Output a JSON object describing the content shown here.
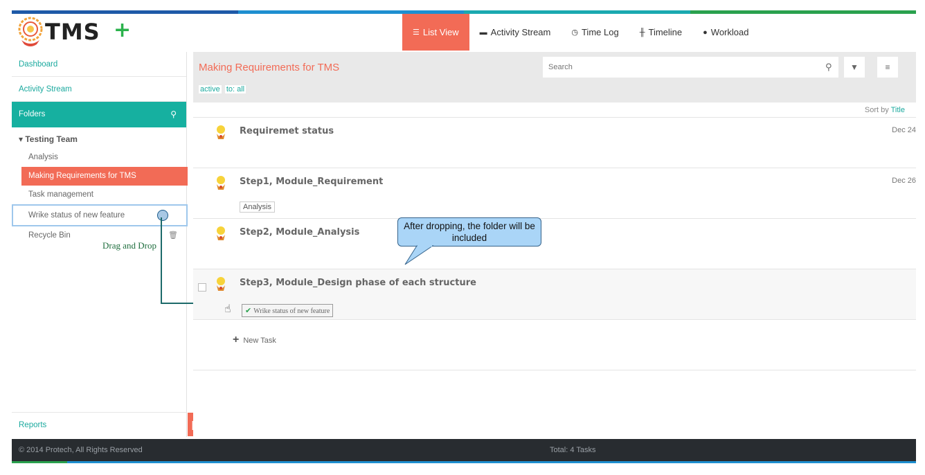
{
  "colors": {
    "accent": "#f26b56",
    "teal": "#16b0a0",
    "stripe": [
      "#1e5aa8",
      "#1e8fd0",
      "#1aa9b0",
      "#2aa14e"
    ]
  },
  "header": {
    "logo_text": "TMS",
    "add_label": "+",
    "nav": [
      {
        "label": "List View",
        "icon": "list-icon"
      },
      {
        "label": "Activity Stream",
        "icon": "comment-icon"
      },
      {
        "label": "Time Log",
        "icon": "clock-icon"
      },
      {
        "label": "Timeline",
        "icon": "timeline-icon"
      },
      {
        "label": "Workload",
        "icon": "user-icon"
      }
    ]
  },
  "sidebar": {
    "dashboard": "Dashboard",
    "activity": "Activity Stream",
    "folders": "Folders",
    "team": "Testing Team",
    "items": [
      "Analysis",
      "Making Requirements for TMS",
      "Task management",
      "Wrike status of new feature",
      "Recycle Bin"
    ],
    "reports": "Reports"
  },
  "annotation": {
    "drag_label": "Drag and Drop",
    "callout": "After dropping, the folder will be included"
  },
  "main": {
    "title": "Making Requirements for TMS",
    "filters": [
      "active",
      "to: all"
    ],
    "search_placeholder": "Search",
    "sort_prefix": "Sort by",
    "sort_field": "Title",
    "tasks": [
      {
        "title": "Requiremet status",
        "date": "Dec 24",
        "tag": ""
      },
      {
        "title": "Step1, Module_Requirement",
        "date": "Dec 26",
        "tag": "Analysis"
      },
      {
        "title": "Step2, Module_Analysis",
        "date": "",
        "tag": ""
      },
      {
        "title": "Step3, Module_Design phase of each structure",
        "date": "",
        "tag": "Wrike status of new feature"
      }
    ],
    "new_task": "New Task"
  },
  "footer": {
    "copyright": "© 2014 Protech, All Rights Reserved",
    "total": "Total: 4 Tasks"
  }
}
